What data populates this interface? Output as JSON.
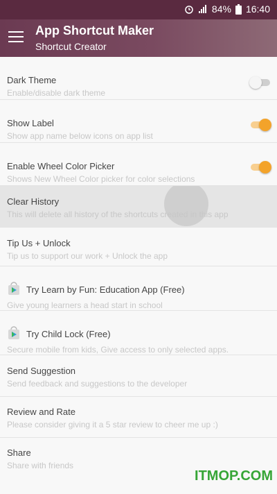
{
  "status_bar": {
    "battery": "84%",
    "time": "16:40",
    "icons": [
      "alarm-icon",
      "signal-icon",
      "battery-icon"
    ]
  },
  "app_bar": {
    "title": "App Shortcut Maker",
    "subtitle": "Shortcut Creator",
    "menu_icon": "hamburger-icon"
  },
  "settings": [
    {
      "title": "Dark Theme",
      "subtitle": "Enable/disable dark theme",
      "toggle": "off"
    },
    {
      "title": "Show Label",
      "subtitle": "Show app name below icons on app list",
      "toggle": "on"
    },
    {
      "title": "Enable Wheel Color Picker",
      "subtitle": "Shows New Wheel Color picker for color selections",
      "toggle": "on"
    },
    {
      "title": "Clear History",
      "subtitle": "This will delete all history of the shortcuts created in this app"
    },
    {
      "title": "Tip Us + Unlock",
      "subtitle": "Tip us to support our work + Unlock the app"
    },
    {
      "title": "Try Learn by Fun: Education App (Free)",
      "subtitle": "Give young learners a head start in school",
      "icon": "play-store-icon"
    },
    {
      "title": "Try Child Lock (Free)",
      "subtitle": "Secure mobile from kids, Give access to only selected apps.",
      "icon": "play-store-icon"
    },
    {
      "title": "Send Suggestion",
      "subtitle": "Send feedback and suggestions to the developer"
    },
    {
      "title": "Review and Rate",
      "subtitle": "Please consider giving it a 5 star review to cheer me up :)"
    },
    {
      "title": "Share",
      "subtitle": "Share with friends"
    }
  ],
  "watermark": "ITMOP.COM",
  "colors": {
    "appbar": "#6b3a52",
    "accent": "#f3a32a"
  }
}
